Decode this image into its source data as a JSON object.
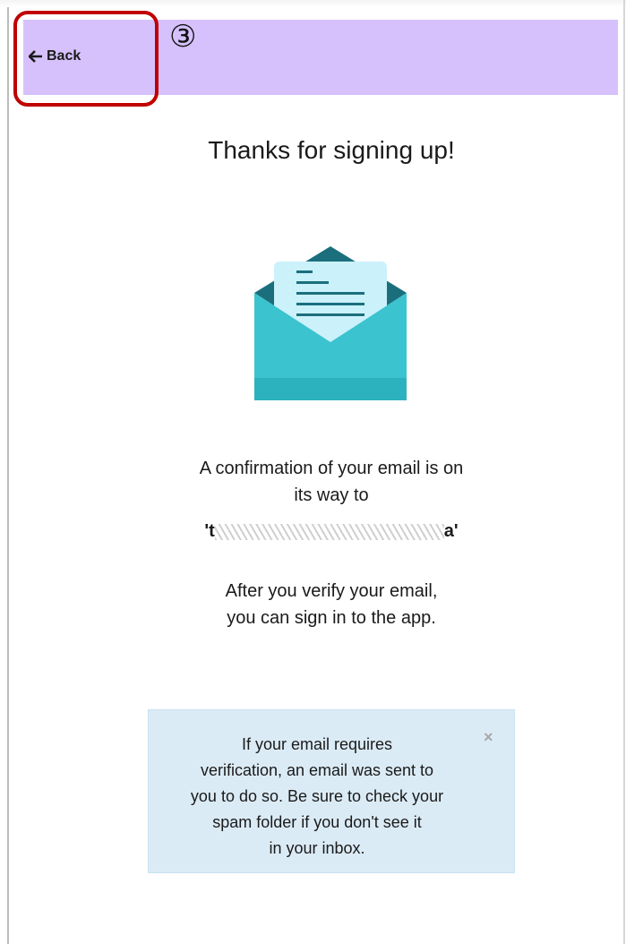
{
  "header": {
    "back_label": "Back",
    "step_marker": "③",
    "accent_color": "#d6c1fd",
    "annotation_color": "#c00000"
  },
  "main": {
    "title": "Thanks for signing up!",
    "illustration_icon": "open-envelope-letter",
    "confirmation_line1": "A confirmation of your email is on",
    "confirmation_line2": "its way to",
    "email_prefix": "'t",
    "email_suffix": "a'",
    "verify_line1": "After you verify your email,",
    "verify_line2": "you can sign in to the app."
  },
  "alert": {
    "line1": "If your email requires",
    "line2": "verification, an email was sent to",
    "line3": "you to do so. Be sure to check your",
    "line4": "spam folder if you don't see it",
    "line5": "in your inbox.",
    "close_label": "×",
    "background_color": "#dbebf6"
  }
}
